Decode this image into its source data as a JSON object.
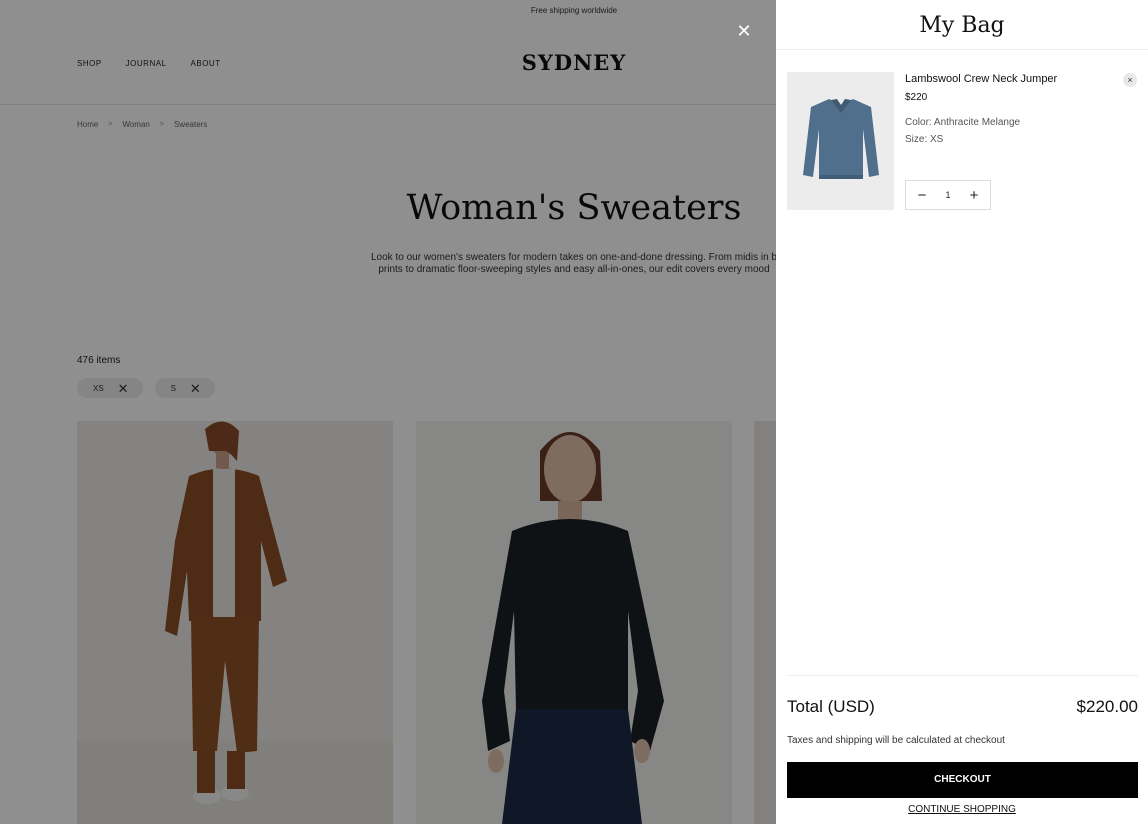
{
  "announcement": "Free shipping worldwide",
  "nav": {
    "shop": "SHOP",
    "journal": "JOURNAL",
    "about": "ABOUT"
  },
  "brand": "SYDNEY",
  "breadcrumb": {
    "home": "Home",
    "woman": "Woman",
    "sweaters": "Sweaters",
    "separator": ">"
  },
  "category": {
    "title": "Woman's Sweaters",
    "description_line1": "Look to our women's sweaters for modern takes on one-and-done dressing. From midis in b",
    "description_line2": "prints to dramatic floor-sweeping styles and easy all-in-ones, our edit covers every mood"
  },
  "listing": {
    "count": "476 items",
    "filters": [
      {
        "label": "XS",
        "remove": "✕"
      },
      {
        "label": "S",
        "remove": "✕"
      }
    ]
  },
  "overlay_close": "✕",
  "bag": {
    "title": "My Bag",
    "item": {
      "name": "Lambswool Crew Neck Jumper",
      "price": "$220",
      "color": "Color: Anthracite Melange",
      "size": "Size: XS",
      "quantity": "1",
      "remove": "×",
      "minus": "−",
      "plus": "+",
      "image_color": "#4f6f8c"
    },
    "total_label": "Total (USD)",
    "total_value": "$220.00",
    "tax_note": "Taxes and shipping will be calculated at checkout",
    "checkout": "CHECKOUT",
    "continue": "CONTINUE SHOPPING"
  },
  "icons": {
    "grid_2": "grid-two-columns-icon",
    "grid_3": "grid-three-columns-icon"
  }
}
